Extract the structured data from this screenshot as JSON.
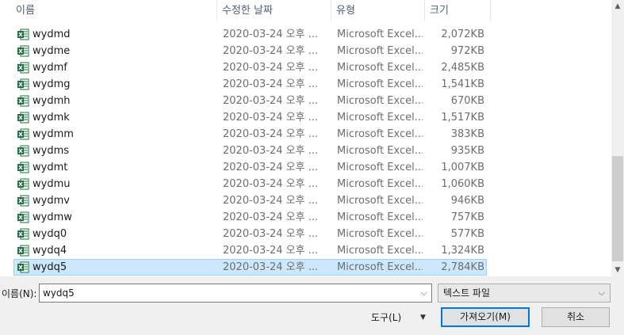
{
  "columns": {
    "name": "이름",
    "date": "수정한 날짜",
    "type": "유형",
    "size": "크기"
  },
  "sort_indicator": "^",
  "files": [
    {
      "name": "wydmd",
      "date": "2020-03-24 오후 ...",
      "type": "Microsoft Excel...",
      "size": "2,072KB"
    },
    {
      "name": "wydme",
      "date": "2020-03-24 오후 ...",
      "type": "Microsoft Excel...",
      "size": "972KB"
    },
    {
      "name": "wydmf",
      "date": "2020-03-24 오후 ...",
      "type": "Microsoft Excel...",
      "size": "2,485KB"
    },
    {
      "name": "wydmg",
      "date": "2020-03-24 오후 ...",
      "type": "Microsoft Excel...",
      "size": "1,541KB"
    },
    {
      "name": "wydmh",
      "date": "2020-03-24 오후 ...",
      "type": "Microsoft Excel...",
      "size": "670KB"
    },
    {
      "name": "wydmk",
      "date": "2020-03-24 오후 ...",
      "type": "Microsoft Excel...",
      "size": "1,517KB"
    },
    {
      "name": "wydmm",
      "date": "2020-03-24 오후 ...",
      "type": "Microsoft Excel...",
      "size": "383KB"
    },
    {
      "name": "wydms",
      "date": "2020-03-24 오후 ...",
      "type": "Microsoft Excel...",
      "size": "935KB"
    },
    {
      "name": "wydmt",
      "date": "2020-03-24 오후 ...",
      "type": "Microsoft Excel...",
      "size": "1,007KB"
    },
    {
      "name": "wydmu",
      "date": "2020-03-24 오후 ...",
      "type": "Microsoft Excel...",
      "size": "1,060KB"
    },
    {
      "name": "wydmv",
      "date": "2020-03-24 오후 ...",
      "type": "Microsoft Excel...",
      "size": "946KB"
    },
    {
      "name": "wydmw",
      "date": "2020-03-24 오후 ...",
      "type": "Microsoft Excel...",
      "size": "757KB"
    },
    {
      "name": "wydq0",
      "date": "2020-03-24 오후 ...",
      "type": "Microsoft Excel...",
      "size": "577KB"
    },
    {
      "name": "wydq4",
      "date": "2020-03-24 오후 ...",
      "type": "Microsoft Excel...",
      "size": "1,324KB"
    },
    {
      "name": "wydq5",
      "date": "2020-03-24 오후 ...",
      "type": "Microsoft Excel...",
      "size": "2,784KB",
      "selected": true
    }
  ],
  "file_icon": "excel-file-icon",
  "filename": {
    "label": "이름(N):",
    "value": "wydq5"
  },
  "file_type": {
    "selected": "텍스트 파일"
  },
  "tools_label": "도구(L)",
  "open_label": "가져오기(M)",
  "cancel_label": "취소",
  "colors": {
    "selection_bg": "#cce8ff",
    "selection_border": "#99d1ff",
    "default_button_border": "#0078d7",
    "excel_green": "#1d6f42"
  }
}
